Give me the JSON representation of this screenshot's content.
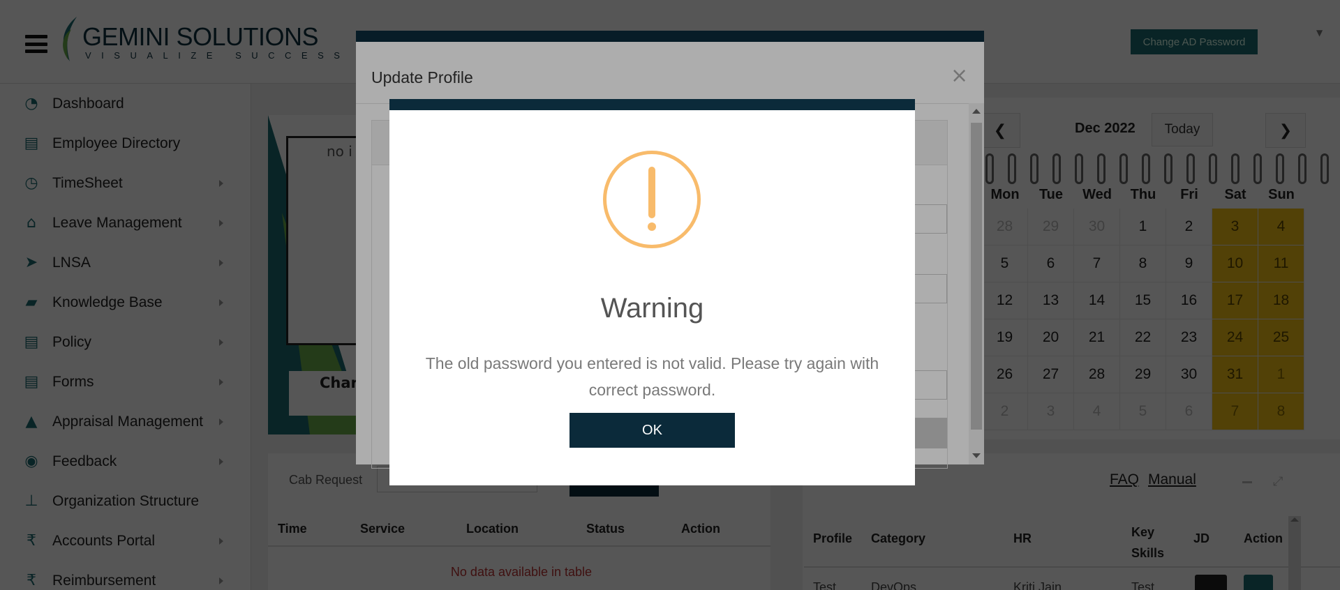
{
  "header": {
    "logo_name": "GEMINI SOLUTIONS",
    "logo_tagline": "VISUALIZE SUCCESS",
    "change_password_label": "Change AD Password"
  },
  "sidebar": {
    "items": [
      {
        "label": "Dashboard",
        "icon": "dashboard-icon",
        "glyph": "◔",
        "has_submenu": false
      },
      {
        "label": "Employee Directory",
        "icon": "contacts-icon",
        "glyph": "▤",
        "has_submenu": false
      },
      {
        "label": "TimeSheet",
        "icon": "clock-icon",
        "glyph": "◷",
        "has_submenu": true
      },
      {
        "label": "Leave Management",
        "icon": "home-icon",
        "glyph": "⌂",
        "has_submenu": true
      },
      {
        "label": "LNSA",
        "icon": "send-icon",
        "glyph": "➤",
        "has_submenu": true
      },
      {
        "label": "Knowledge Base",
        "icon": "folder-icon",
        "glyph": "▰",
        "has_submenu": true
      },
      {
        "label": "Policy",
        "icon": "document-icon",
        "glyph": "▤",
        "has_submenu": true
      },
      {
        "label": "Forms",
        "icon": "form-icon",
        "glyph": "▤",
        "has_submenu": true
      },
      {
        "label": "Appraisal Management",
        "icon": "graduation-cap-icon",
        "glyph": "▲",
        "has_submenu": true
      },
      {
        "label": "Feedback",
        "icon": "comments-icon",
        "glyph": "◉",
        "has_submenu": true
      },
      {
        "label": "Organization Structure",
        "icon": "sitemap-icon",
        "glyph": "⊥",
        "has_submenu": false
      },
      {
        "label": "Accounts Portal",
        "icon": "rupee-icon",
        "glyph": "₹",
        "has_submenu": true
      },
      {
        "label": "Reimbursement",
        "icon": "rupee-icon",
        "glyph": "₹",
        "has_submenu": true
      }
    ]
  },
  "promo": {
    "image_alt": "no i",
    "caption": "Char"
  },
  "cab": {
    "label": "Cab Request",
    "columns": [
      "Time",
      "Service",
      "Location",
      "Status",
      "Action"
    ],
    "empty_text": "No data available in table"
  },
  "calendar": {
    "month": "Dec 2022",
    "today_label": "Today",
    "prev_label": "❮",
    "next_label": "❯",
    "days": [
      "Mon",
      "Tue",
      "Wed",
      "Thu",
      "Fri",
      "Sat",
      "Sun"
    ],
    "weeks": [
      [
        "28",
        "29",
        "30",
        "1",
        "2",
        "3",
        "4"
      ],
      [
        "5",
        "6",
        "7",
        "8",
        "9",
        "10",
        "11"
      ],
      [
        "12",
        "13",
        "14",
        "15",
        "16",
        "17",
        "18"
      ],
      [
        "19",
        "20",
        "21",
        "22",
        "23",
        "24",
        "25"
      ],
      [
        "26",
        "27",
        "28",
        "29",
        "30",
        "31",
        "1"
      ],
      [
        "2",
        "3",
        "4",
        "5",
        "6",
        "7",
        "8"
      ]
    ],
    "muted": [
      [
        true,
        true,
        true,
        false,
        false,
        false,
        false
      ],
      [
        false,
        false,
        false,
        false,
        false,
        false,
        false
      ],
      [
        false,
        false,
        false,
        false,
        false,
        false,
        false
      ],
      [
        false,
        false,
        false,
        false,
        false,
        false,
        false
      ],
      [
        false,
        false,
        false,
        false,
        false,
        false,
        true
      ],
      [
        true,
        true,
        true,
        true,
        true,
        true,
        true
      ]
    ],
    "weekend_color": "#f3c117"
  },
  "jobs": {
    "faq_label": "FAQ",
    "manual_label": "Manual",
    "columns": [
      "Profile",
      "Category",
      "HR",
      "Key Skills",
      "JD",
      "Action"
    ],
    "row": [
      "Test",
      "DevOps",
      "Kriti Jain",
      "Test"
    ]
  },
  "profile_modal": {
    "title": "Update Profile",
    "close_label": "×"
  },
  "alert": {
    "title": "Warning",
    "message": "The old password you entered is not valid. Please try again with correct password.",
    "ok_label": "OK",
    "icon": "warning-exclamation-icon",
    "icon_color": "#f8bb6b",
    "button_color": "#0b2a3a"
  }
}
